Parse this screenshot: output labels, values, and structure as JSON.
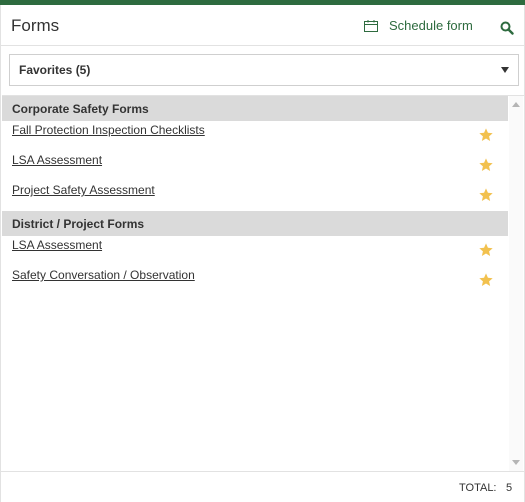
{
  "header": {
    "title": "Forms",
    "schedule_label": "Schedule form"
  },
  "filter": {
    "selected": "Favorites (5)"
  },
  "groups": [
    {
      "title": "Corporate Safety Forms",
      "items": [
        "Fall Protection Inspection Checklists",
        "LSA Assessment",
        "Project Safety Assessment"
      ]
    },
    {
      "title": "District / Project Forms",
      "items": [
        "LSA Assessment",
        "Safety Conversation / Observation"
      ]
    }
  ],
  "footer": {
    "total_label": "TOTAL:",
    "total_value": "5"
  },
  "colors": {
    "accent": "#2e6b3f",
    "star": "#f2c14e",
    "group_bg": "#dadada"
  },
  "icons": {
    "schedule": "calendar-icon",
    "search": "search-icon",
    "favorite": "star-icon",
    "dropdown": "caret-down-icon"
  }
}
